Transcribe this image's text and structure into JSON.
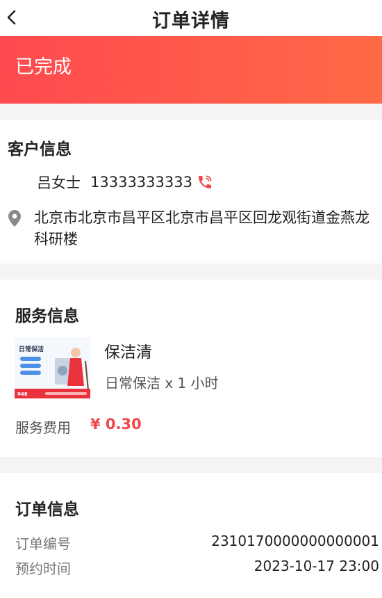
{
  "header": {
    "title": "订单详情"
  },
  "status": {
    "text": "已完成"
  },
  "customer": {
    "section_title": "客户信息",
    "name": "吕女士",
    "phone": "13333333333",
    "address": "北京市北京市昌平区北京市昌平区回龙观街道金燕龙科研楼"
  },
  "service": {
    "section_title": "服务信息",
    "name": "保洁清",
    "spec": "日常保洁 x 1 小时",
    "fee_label": "服务费用",
    "fee_value": "¥ 0.30",
    "thumbnail": {
      "title": "日常保洁",
      "price": "¥48"
    }
  },
  "order": {
    "section_title": "订单信息",
    "rows": [
      {
        "label": "订单编号",
        "value": "2310170000000000001"
      },
      {
        "label": "预约时间",
        "value": "2023-10-17 23:00"
      }
    ]
  },
  "colors": {
    "accent": "#f0474a",
    "banner_start": "#ff4a4f",
    "banner_end": "#ff6a45"
  }
}
